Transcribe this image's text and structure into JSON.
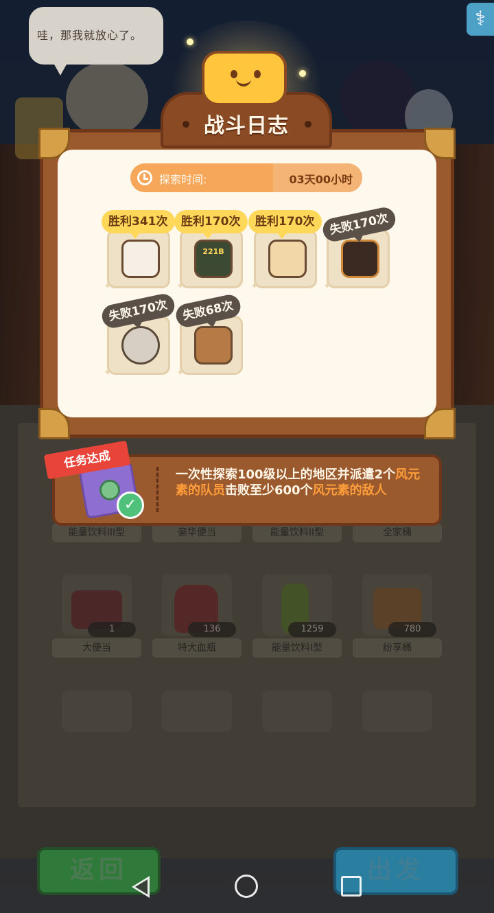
{
  "speech_bubble": {
    "text": "哇，那我就放心了。"
  },
  "close_button": {
    "icon": "share-close-icon"
  },
  "dialog": {
    "title": "战斗日志",
    "exploration": {
      "label": "探索时间:",
      "value": "03天00小时"
    },
    "enemies": [
      {
        "result": "胜利341次",
        "outcome": "win",
        "icon": "calico-cat-enemy-icon",
        "color": "#f5efe6"
      },
      {
        "result": "胜利170次",
        "outcome": "win",
        "icon": "tv-monster-enemy-icon",
        "color": "#3c4a33",
        "screen_text": "221B"
      },
      {
        "result": "胜利170次",
        "outcome": "win",
        "icon": "box-creature-enemy-icon",
        "color": "#f2d8a8"
      },
      {
        "result": "失败170次",
        "outcome": "lose",
        "icon": "drum-creature-enemy-icon",
        "color": "#3b2a22"
      },
      {
        "result": "失败170次",
        "outcome": "lose",
        "icon": "handcuffs-enemy-icon",
        "color": "#d7cfc3"
      },
      {
        "result": "失败68次",
        "outcome": "lose",
        "icon": "lantern-box-enemy-icon",
        "color": "#b57a45"
      }
    ]
  },
  "mission": {
    "tag": "任务达成",
    "text_parts": [
      {
        "text": "一次性探索100级以上的地区并派遣2个",
        "highlight": false
      },
      {
        "text": "风元素的队员",
        "highlight": true
      },
      {
        "text": "击败至少600个",
        "highlight": false
      },
      {
        "text": "风元素的敌人",
        "highlight": true
      }
    ],
    "icon": "check-icon"
  },
  "inventory": {
    "row1_labels": [
      "能量饮料III型",
      "豪华便当",
      "能量饮料II型",
      "全家桶"
    ],
    "row2": [
      {
        "name": "大便当",
        "count": "1"
      },
      {
        "name": "特大血瓶",
        "count": "136"
      },
      {
        "name": "能量饮料I型",
        "count": "1259"
      },
      {
        "name": "纷享桶",
        "count": "780"
      }
    ]
  },
  "buttons": {
    "back": "返回",
    "go": "出发"
  },
  "nav": {
    "back": "nav-back-icon",
    "home": "nav-home-icon",
    "recent": "nav-recent-icon"
  }
}
